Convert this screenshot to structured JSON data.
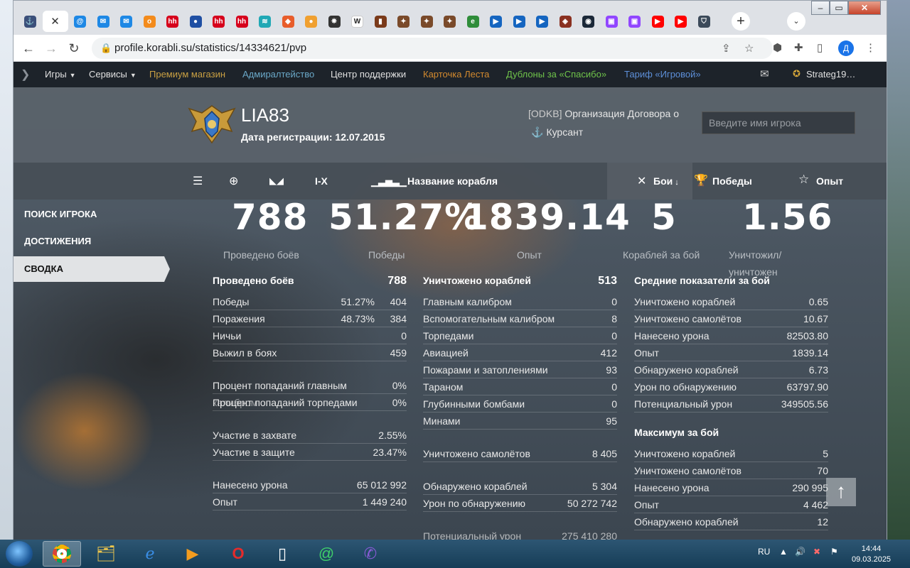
{
  "browser": {
    "tabs": [
      {
        "icon": "wows-icon",
        "color": "#3b4f7a",
        "glyph": "⚓"
      },
      {
        "icon": "close-icon",
        "active": true
      },
      {
        "icon": "mail-at-icon",
        "color": "#1e88e5",
        "glyph": "@"
      },
      {
        "icon": "mail-icon",
        "color": "#1e88e5",
        "glyph": "✉"
      },
      {
        "icon": "mail-icon",
        "color": "#1e88e5",
        "glyph": "✉"
      },
      {
        "icon": "ok-icon",
        "color": "#f38b1c",
        "glyph": "о"
      },
      {
        "icon": "hh-icon",
        "color": "#d6001c",
        "glyph": "hh"
      },
      {
        "icon": "ruport-icon",
        "color": "#1f4fa3",
        "glyph": "●"
      },
      {
        "icon": "hh-icon",
        "color": "#d6001c",
        "glyph": "hh"
      },
      {
        "icon": "hh-icon",
        "color": "#d6001c",
        "glyph": "hh"
      },
      {
        "icon": "wave-icon",
        "color": "#20a8b5",
        "glyph": "≋"
      },
      {
        "icon": "ritual-icon",
        "color": "#e85d2b",
        "glyph": "◆"
      },
      {
        "icon": "ball-icon",
        "color": "#f0a030",
        "glyph": "●"
      },
      {
        "icon": "wheel-icon",
        "color": "#333333",
        "glyph": "✵"
      },
      {
        "icon": "wikipedia-icon",
        "color": "#ffffff",
        "glyph": "W"
      },
      {
        "icon": "chart-icon",
        "color": "#7a3a1a",
        "glyph": "▮"
      },
      {
        "icon": "game-icon",
        "color": "#7a4a2a",
        "glyph": "✦"
      },
      {
        "icon": "game-icon",
        "color": "#7a4a2a",
        "glyph": "✦"
      },
      {
        "icon": "game-icon",
        "color": "#7a4a2a",
        "glyph": "✦"
      },
      {
        "icon": "egov-icon",
        "color": "#2f8d3a",
        "glyph": "e"
      },
      {
        "icon": "play-icon",
        "color": "#1565c0",
        "glyph": "▶"
      },
      {
        "icon": "play-icon",
        "color": "#1565c0",
        "glyph": "▶"
      },
      {
        "icon": "play-icon",
        "color": "#1565c0",
        "glyph": "▶"
      },
      {
        "icon": "dota-icon",
        "color": "#8a3020",
        "glyph": "◈"
      },
      {
        "icon": "steam-icon",
        "color": "#1b2838",
        "glyph": "◉"
      },
      {
        "icon": "twitch-icon",
        "color": "#9146ff",
        "glyph": "▣"
      },
      {
        "icon": "twitch-icon",
        "color": "#9146ff",
        "glyph": "▣"
      },
      {
        "icon": "youtube-icon",
        "color": "#ff0000",
        "glyph": "▶"
      },
      {
        "icon": "youtube-icon",
        "color": "#ff0000",
        "glyph": "▶"
      },
      {
        "icon": "shield-icon",
        "color": "#3c4a5a",
        "glyph": "⛉"
      }
    ],
    "url": "profile.korabli.su/statistics/14334621/pvp",
    "profile_letter": "Д"
  },
  "topnav": {
    "games": "Игры",
    "services": "Сервисы",
    "premium": "Премиум магазин",
    "admiralty": "Адмиралтейство",
    "support": "Центр поддержки",
    "lesta_card": "Карточка Леста",
    "doubloons": "Дублоны за «Спасибо»",
    "tariff": "Тариф «Игровой»",
    "user": "Strateg19…",
    "colors": {
      "premium": "#c9a043",
      "admiralty": "#6aa8c8",
      "lesta_card": "#d38a2e",
      "doubloons": "#6fc34a",
      "tariff": "#5d8fd8"
    }
  },
  "player": {
    "name": "LIA83",
    "reg_date": "Дата регистрации: 12.07.2015",
    "clan_tag": "[ODKB]",
    "clan_name": " Организация Договора о",
    "rank": "Курсант",
    "search_placeholder": "Введите имя игрока"
  },
  "filters": {
    "tier": "I-X",
    "ship_name": "Название корабля",
    "battles": "Бои",
    "wins": "Победы",
    "xp": "Опыт"
  },
  "sidebar": [
    {
      "label": "ПОИСК ИГРОКА",
      "active": false
    },
    {
      "label": "ДОСТИЖЕНИЯ",
      "active": false
    },
    {
      "label": "СВОДКА",
      "active": true
    }
  ],
  "summary": {
    "battles": "788",
    "winrate": "51.27%",
    "xp": "1839.14",
    "ships": "5",
    "kd": "1.56",
    "battles_label": "Проведено боёв",
    "winrate_label": "Победы",
    "xp_label": "Опыт",
    "ships_label": "Кораблей за бой",
    "kd_label_1": "Уничтожил/",
    "kd_label_2": "уничтожен"
  },
  "col1": {
    "title": "Проведено боёв",
    "title_value": "788",
    "wins": {
      "k": "Победы",
      "p": "51.27%",
      "v": "404"
    },
    "losses": {
      "k": "Поражения",
      "p": "48.73%",
      "v": "384"
    },
    "draws": {
      "k": "Ничьи",
      "v": "0"
    },
    "survived": {
      "k": "Выжил в боях",
      "v": "459"
    },
    "main_hit": {
      "k": "Процент попаданий главным",
      "v": "0%"
    },
    "main_hit_2": "калибром",
    "torp_hit": {
      "k": "Процент попаданий торпедами",
      "v": "0%"
    },
    "capture": {
      "k": "Участие в захвате",
      "v": "2.55%"
    },
    "defense": {
      "k": "Участие в защите",
      "v": "23.47%"
    },
    "damage": {
      "k": "Нанесено урона",
      "v": "65 012 992"
    },
    "exp": {
      "k": "Опыт",
      "v": "1 449 240"
    }
  },
  "col2": {
    "title": "Уничтожено кораблей",
    "title_value": "513",
    "rows": [
      {
        "k": "Главным калибром",
        "v": "0"
      },
      {
        "k": "Вспомогательным калибром",
        "v": "8"
      },
      {
        "k": "Торпедами",
        "v": "0"
      },
      {
        "k": "Авиацией",
        "v": "412"
      },
      {
        "k": "Пожарами и затоплениями",
        "v": "93"
      },
      {
        "k": "Тараном",
        "v": "0"
      },
      {
        "k": "Глубинными бомбами",
        "v": "0"
      },
      {
        "k": "Минами",
        "v": "95"
      }
    ],
    "planes": {
      "k": "Уничтожено самолётов",
      "v": "8 405"
    },
    "spotted": {
      "k": "Обнаружено кораблей",
      "v": "5 304"
    },
    "spot_dmg": {
      "k": "Урон по обнаружению",
      "v": "50 272 742"
    },
    "potential": {
      "k": "Потенциальный урон",
      "v": "275 410 280"
    }
  },
  "col3": {
    "title": "Средние показатели за бой",
    "rows": [
      {
        "k": "Уничтожено кораблей",
        "v": "0.65"
      },
      {
        "k": "Уничтожено самолётов",
        "v": "10.67"
      },
      {
        "k": "Нанесено урона",
        "v": "82503.80"
      },
      {
        "k": "Опыт",
        "v": "1839.14"
      },
      {
        "k": "Обнаружено кораблей",
        "v": "6.73"
      },
      {
        "k": "Урон по обнаружению",
        "v": "63797.90"
      },
      {
        "k": "Потенциальный урон",
        "v": "349505.56"
      }
    ],
    "max_title": "Максимум за бой",
    "max_rows": [
      {
        "k": "Уничтожено кораблей",
        "v": "5"
      },
      {
        "k": "Уничтожено самолётов",
        "v": "70"
      },
      {
        "k": "Нанесено урона",
        "v": "290 995"
      },
      {
        "k": "Опыт",
        "v": "4 462"
      },
      {
        "k": "Обнаружено кораблей",
        "v": "12"
      }
    ]
  },
  "taskbar": {
    "lang": "RU",
    "time": "14:44",
    "date": "09.03.2025"
  }
}
